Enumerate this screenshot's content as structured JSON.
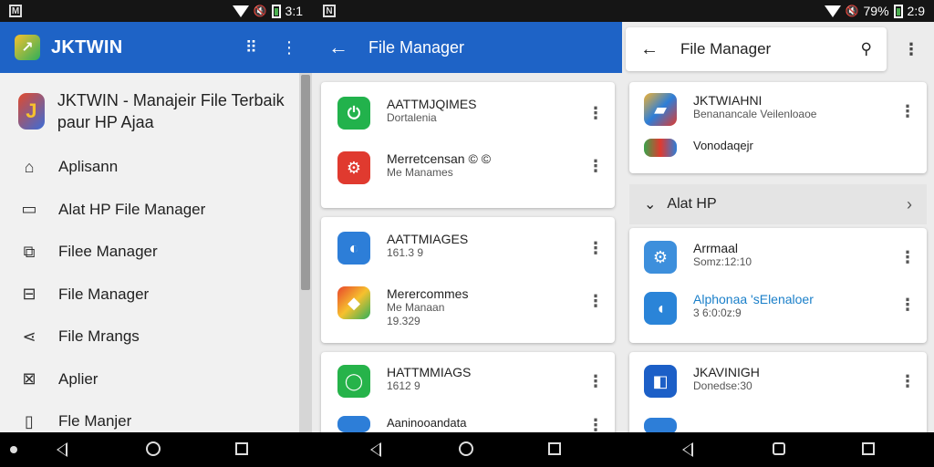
{
  "status": {
    "left_badge": "M",
    "left_time": "3:1",
    "right_badge": "N",
    "battery": "79%",
    "right_time": "2:9"
  },
  "panel1": {
    "app_title": "JKTWIN",
    "drawer_title": "JKTWIN - Manajeir File Terbaik paur HP Ajaa",
    "items": [
      {
        "label": "Aplisann",
        "icon": "store-icon"
      },
      {
        "label": "Alat HP File Manager",
        "icon": "folder-icon"
      },
      {
        "label": "Filee Manager",
        "icon": "image-icon"
      },
      {
        "label": "File Manager",
        "icon": "briefcase-icon"
      },
      {
        "label": "File Mrangs",
        "icon": "share-icon"
      },
      {
        "label": "Aplier",
        "icon": "crop-icon"
      },
      {
        "label": "Fle Manjer",
        "icon": "file-icon"
      }
    ]
  },
  "panel2": {
    "title": "File Manager",
    "cards": [
      {
        "rows": [
          {
            "t1": "AATTMJQIMES",
            "t2": "Dortalenia",
            "t3": "",
            "color": "#22b24c",
            "glyph": "⏻"
          },
          {
            "t1": "Merretcensan © ©",
            "t2": "Me Manames",
            "t3": "",
            "color": "#e03a2f",
            "glyph": "⚙"
          }
        ]
      },
      {
        "rows": [
          {
            "t1": "AATTMIAGES",
            "t2": "161.3 9",
            "t3": "",
            "color": "#2d7ed8",
            "glyph": "◐"
          },
          {
            "t1": "Merercommes",
            "t2": "Me Manaan",
            "t3": "19.329",
            "color": "#e8452c",
            "glyph": "◆"
          }
        ]
      },
      {
        "rows": [
          {
            "t1": "HATTMMIAGS",
            "t2": "1612 9",
            "t3": "",
            "color": "#26b34a",
            "glyph": "◯"
          },
          {
            "t1": "Aaninooandata",
            "t2": "",
            "t3": "",
            "color": "#2d7ed8",
            "glyph": "■"
          }
        ]
      }
    ]
  },
  "panel3": {
    "title": "File Manager",
    "section_label": "Alat HP",
    "cards": [
      {
        "rows": [
          {
            "t1": "JKTWIAHNI",
            "t2": "Benanancale Veilenloaoe",
            "link": false,
            "color": "#f0b233",
            "glyph": "▰"
          },
          {
            "t1": "Vonodaqejr",
            "t2": "",
            "link": false,
            "color": "#3aa34a",
            "glyph": "▦"
          }
        ]
      },
      {
        "rows": [
          {
            "t1": "Arrmaal",
            "t2": "Somz:12:10",
            "link": false,
            "color": "#3d8fdc",
            "glyph": "⚙"
          },
          {
            "t1": "Alphonaa 'sElenaloer",
            "t2": "3 6:0:0z:9",
            "link": true,
            "color": "#2a84d8",
            "glyph": "◖"
          }
        ]
      },
      {
        "rows": [
          {
            "t1": "JKAVINIGH",
            "t2": "Donedse:30",
            "link": false,
            "color": "#1c5fc7",
            "glyph": "◧"
          },
          {
            "t1": "",
            "t2": "",
            "link": false,
            "color": "#2d7ed8",
            "glyph": "■"
          }
        ]
      }
    ]
  }
}
